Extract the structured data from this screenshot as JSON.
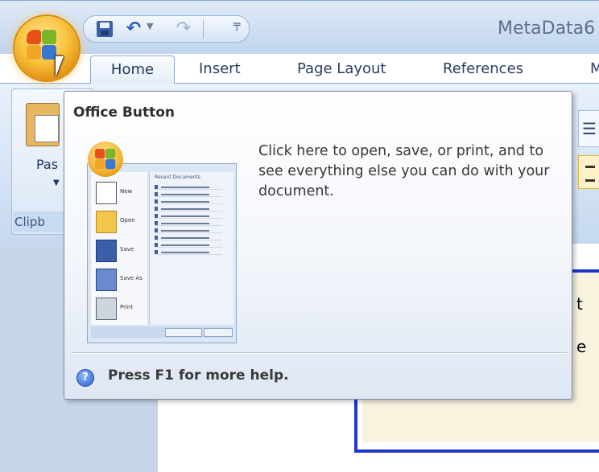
{
  "window": {
    "title": "MetaData6"
  },
  "quick_access_toolbar": {
    "items": [
      {
        "name": "save-icon"
      },
      {
        "name": "undo-icon",
        "glyph": "↶"
      },
      {
        "name": "redo-icon",
        "glyph": "↷"
      },
      {
        "name": "customize-icon",
        "glyph": "╤"
      }
    ]
  },
  "ribbon": {
    "tabs": [
      {
        "label": "Home",
        "selected": true
      },
      {
        "label": "Insert"
      },
      {
        "label": "Page Layout"
      },
      {
        "label": "References"
      },
      {
        "label": "Ma"
      }
    ],
    "paste_label": "Pas",
    "clipboard_group_label": "Clipb"
  },
  "document": {
    "side_text_1": "t",
    "side_text_2": "e"
  },
  "tooltip": {
    "title": "Office Button",
    "body": "Click here to open, save, or print, and to see everything else you can do with your document.",
    "help": "Press F1 for more help."
  },
  "preview": {
    "recent_title": "Recent Documents",
    "menu": [
      {
        "label": "New",
        "icon": "new-icon"
      },
      {
        "label": "Open",
        "icon": "open-icon"
      },
      {
        "label": "Save",
        "icon": "save-icon"
      },
      {
        "label": "Save As",
        "icon": "save-as-icon"
      },
      {
        "label": "Print",
        "icon": "print-icon"
      }
    ]
  },
  "colors": {
    "tooltip_border": "#7e8da4",
    "ribbon_text": "#2a3e63",
    "page_border": "#1f37c7",
    "office_button": "#f8c23b"
  }
}
